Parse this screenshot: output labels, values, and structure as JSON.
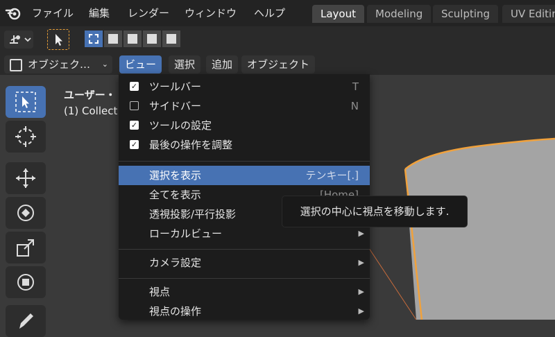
{
  "menubar": {
    "items": [
      "ファイル",
      "編集",
      "レンダー",
      "ウィンドウ",
      "ヘルプ"
    ],
    "logo_icon": "blender-logo-icon"
  },
  "workspaces": {
    "tabs": [
      "Layout",
      "Modeling",
      "Sculpting",
      "UV Editin"
    ],
    "active": "Layout"
  },
  "header": {
    "object_mode": "オブジェク…",
    "menus": [
      "ビュー",
      "選択",
      "追加",
      "オブジェクト"
    ],
    "active_menu": "ビュー"
  },
  "viewport": {
    "overlay_line1": "ユーザー・",
    "overlay_line2": "(1) Collect"
  },
  "view_menu": {
    "items": [
      {
        "label": "ツールバー",
        "shortcut": "T",
        "checked": true
      },
      {
        "label": "サイドバー",
        "shortcut": "N",
        "checked": false
      },
      {
        "label": "ツールの設定",
        "shortcut": "",
        "checked": true
      },
      {
        "label": "最後の操作を調整",
        "shortcut": "",
        "checked": true
      },
      {
        "label": "選択を表示",
        "shortcut": "テンキー[.]",
        "highlighted": true
      },
      {
        "label": "全てを表示",
        "shortcut": "[Home]"
      },
      {
        "label": "透視投影/平行投影",
        "shortcut": ""
      },
      {
        "label": "ローカルビュー",
        "shortcut": "",
        "submenu": true
      },
      {
        "label": "カメラ設定",
        "shortcut": "",
        "submenu": true
      },
      {
        "label": "視点",
        "shortcut": "",
        "submenu": true
      },
      {
        "label": "視点の操作",
        "shortcut": "",
        "submenu": true
      }
    ]
  },
  "tooltip": {
    "text": "選択の中心に視点を移動します."
  },
  "colors": {
    "accent": "#4772b3",
    "selection_outline": "#e69d36",
    "menu_bg": "#1c1c1c"
  }
}
